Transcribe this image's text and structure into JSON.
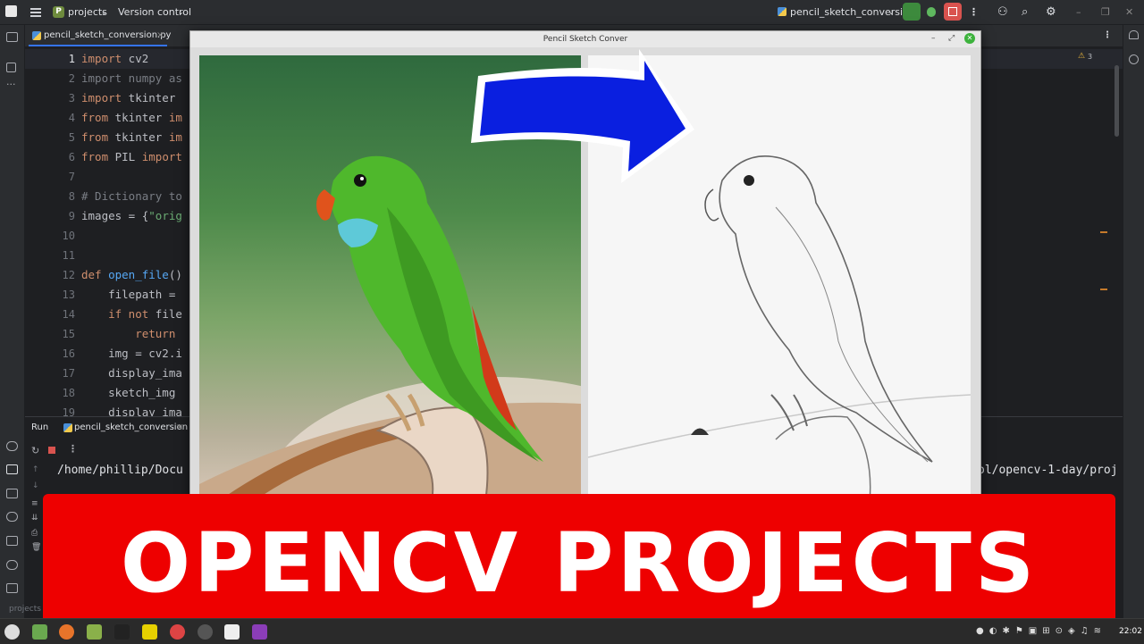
{
  "ide": {
    "project_badge": "P",
    "project_name": "projects",
    "vcs_menu": "Version control",
    "run_config": "pencil_sketch_conversion",
    "editor_tab": "pencil_sketch_conversion.py",
    "close_glyph": "×",
    "warnings_count": "3",
    "line_numbers": [
      "1",
      "2",
      "3",
      "4",
      "5",
      "6",
      "7",
      "8",
      "9",
      "10",
      "11",
      "12",
      "13",
      "14",
      "15",
      "16",
      "17",
      "18",
      "19"
    ],
    "code": {
      "l1_kw": "import",
      "l1_rest": " cv2",
      "l2": "import numpy as",
      "l3_kw": "import",
      "l3_rest": " tkinter",
      "l4_kw": "from",
      "l4_mid": " tkinter ",
      "l4_kw2": "im",
      "l5_kw": "from",
      "l5_mid": " tkinter ",
      "l5_kw2": "im",
      "l6_kw": "from",
      "l6_mid": " PIL ",
      "l6_kw2": "import",
      "l8": "# Dictionary to",
      "l9_a": "images = {",
      "l9_b": "\"orig",
      "l12_kw": "def",
      "l12_fn": " open_file",
      "l12_rest": "()",
      "l13": "    filepath = ",
      "l14_kw": "    if not",
      "l14_rest": " file",
      "l15_kw": "        return",
      "l16": "    img = cv2.i",
      "l17": "    display_ima",
      "l18": "    sketch_img",
      "l19": "    display_ima"
    }
  },
  "run_panel": {
    "tab_run": "Run",
    "tab_config": "pencil_sketch_conversion",
    "console_left": "/home/phillip/Docu",
    "console_right": "ol/opencv-1-day/proj",
    "status_project": "projects"
  },
  "app_window": {
    "title": "Pencil Sketch Conver",
    "minimize": "–",
    "maximize": "⤢",
    "close": "✕"
  },
  "banner": {
    "text": "OPENCV PROJECTS"
  },
  "taskbar": {
    "clock": "22:02"
  },
  "colors": {
    "banner_red": "#ee0000",
    "arrow_blue": "#0a1fe0",
    "parrot_green": "#4fb82c"
  }
}
